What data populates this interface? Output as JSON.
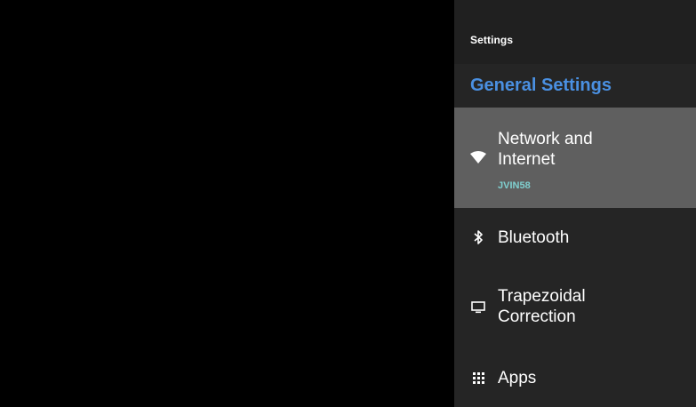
{
  "panel": {
    "title": "Settings",
    "section_heading": "General Settings"
  },
  "items": [
    {
      "label": "Network and\nInternet",
      "subtitle": "JVIN58",
      "icon": "wifi-icon",
      "focused": true
    },
    {
      "label": "Bluetooth",
      "icon": "bluetooth-icon",
      "focused": false
    },
    {
      "label": "Trapezoidal\nCorrection",
      "icon": "display-icon",
      "focused": false
    },
    {
      "label": "Apps",
      "icon": "apps-grid-icon",
      "focused": false
    }
  ],
  "colors": {
    "panel_background": "#252525",
    "header_background": "#202020",
    "focused_item_background": "#5f5f5f",
    "section_heading": "#4a90e2",
    "subtitle": "#7fcfcf"
  }
}
